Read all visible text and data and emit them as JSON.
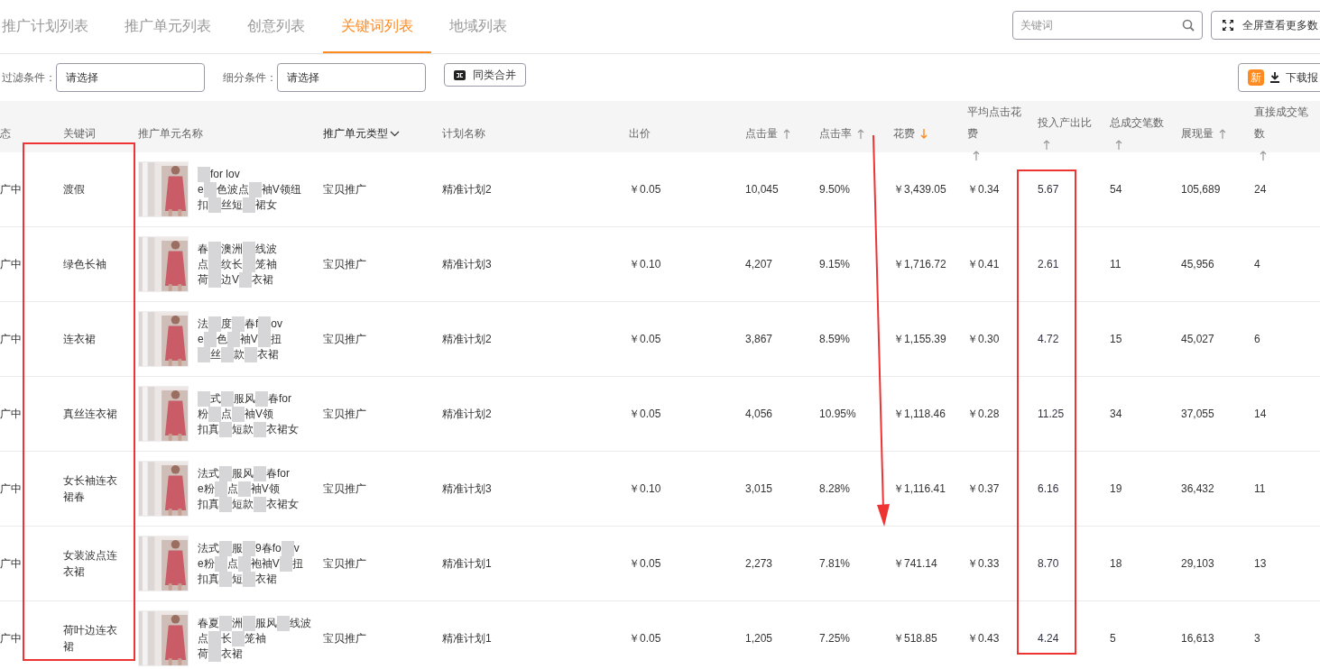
{
  "tabs": [
    {
      "label": "推广计划列表",
      "selected": false
    },
    {
      "label": "推广单元列表",
      "selected": false
    },
    {
      "label": "创意列表",
      "selected": false
    },
    {
      "label": "关键词列表",
      "selected": true
    },
    {
      "label": "地域列表",
      "selected": false
    }
  ],
  "search": {
    "placeholder": "关键词"
  },
  "fullscreen_button": "全屏查看更多数",
  "filters": [
    {
      "label": "过滤条件：",
      "value": "请选择"
    },
    {
      "label": "细分条件：",
      "value": "请选择"
    }
  ],
  "merge_button": "同类合并",
  "download": {
    "badge": "新",
    "label": "下载报"
  },
  "table": {
    "columns": [
      {
        "label": "态"
      },
      {
        "label": "关键词"
      },
      {
        "label": "推广单元名称"
      },
      {
        "label": "推广单元类型",
        "dropdown": true
      },
      {
        "label": "计划名称"
      },
      {
        "label": "出价"
      },
      {
        "label": "点击量",
        "sortable": true,
        "sorted": false
      },
      {
        "label": "点击率",
        "sortable": true,
        "sorted": false
      },
      {
        "label": "花费",
        "sortable": true,
        "sorted": true
      },
      {
        "label": "平均点击花费",
        "sortable": true,
        "sorted": false
      },
      {
        "label": "投入产出比",
        "sortable": true,
        "sorted": false
      },
      {
        "label": "总成交笔数",
        "sortable": true,
        "sorted": false
      },
      {
        "label": "展现量",
        "sortable": true,
        "sorted": false
      },
      {
        "label": "直接成交笔数",
        "sortable": true,
        "sorted": false
      }
    ],
    "rows": [
      {
        "status": "广中",
        "keyword": "渡假",
        "unit_name": [
          [
            {
              "kind": "mask"
            },
            "for lov"
          ],
          [
            "e",
            {
              "kind": "mask"
            },
            "色波点",
            {
              "kind": "mask"
            },
            "袖V领纽"
          ],
          [
            "扣",
            {
              "kind": "mask"
            },
            "丝短",
            {
              "kind": "mask"
            },
            "裙女"
          ]
        ],
        "unit_type": "宝贝推广",
        "plan": "精准计划2",
        "bid": "￥0.05",
        "clicks": "10,045",
        "ctr": "9.50%",
        "cost": "￥3,439.05",
        "avg_cpc": "￥0.34",
        "roi": "5.67",
        "total_deals": "54",
        "impressions": "105,689",
        "direct_deals": "24"
      },
      {
        "status": "广中",
        "keyword": "绿色长袖",
        "unit_name": [
          [
            "春",
            {
              "kind": "mask"
            },
            "澳洲",
            {
              "kind": "mask"
            },
            "线波"
          ],
          [
            "点",
            {
              "kind": "mask"
            },
            "纹长",
            {
              "kind": "mask"
            },
            "笼袖"
          ],
          [
            "荷",
            {
              "kind": "mask"
            },
            "边V",
            {
              "kind": "mask"
            },
            "衣裙"
          ]
        ],
        "unit_type": "宝贝推广",
        "plan": "精准计划3",
        "bid": "￥0.10",
        "clicks": "4,207",
        "ctr": "9.15%",
        "cost": "￥1,716.72",
        "avg_cpc": "￥0.41",
        "roi": "2.61",
        "total_deals": "11",
        "impressions": "45,956",
        "direct_deals": "4"
      },
      {
        "status": "广中",
        "keyword": "连衣裙",
        "unit_name": [
          [
            "法",
            {
              "kind": "mask"
            },
            "度",
            {
              "kind": "mask"
            },
            "春f",
            {
              "kind": "mask"
            },
            "ov"
          ],
          [
            "e",
            {
              "kind": "mask"
            },
            "色",
            {
              "kind": "mask"
            },
            "袖V",
            {
              "kind": "mask"
            },
            "扭"
          ],
          [
            {
              "kind": "mask"
            },
            "丝",
            {
              "kind": "mask"
            },
            "款",
            {
              "kind": "mask"
            },
            "衣裙"
          ]
        ],
        "unit_type": "宝贝推广",
        "plan": "精准计划2",
        "bid": "￥0.05",
        "clicks": "3,867",
        "ctr": "8.59%",
        "cost": "￥1,155.39",
        "avg_cpc": "￥0.30",
        "roi": "4.72",
        "total_deals": "15",
        "impressions": "45,027",
        "direct_deals": "6"
      },
      {
        "status": "广中",
        "keyword": "真丝连衣裙",
        "unit_name": [
          [
            {
              "kind": "mask"
            },
            "式",
            {
              "kind": "mask"
            },
            "服风",
            {
              "kind": "mask"
            },
            "春for"
          ],
          [
            "粉",
            {
              "kind": "mask"
            },
            "点",
            {
              "kind": "mask"
            },
            "袖V领"
          ],
          [
            "扣真",
            {
              "kind": "mask"
            },
            "短款",
            {
              "kind": "mask"
            },
            "衣裙女"
          ]
        ],
        "unit_type": "宝贝推广",
        "plan": "精准计划2",
        "bid": "￥0.05",
        "clicks": "4,056",
        "ctr": "10.95%",
        "cost": "￥1,118.46",
        "avg_cpc": "￥0.28",
        "roi": "11.25",
        "total_deals": "34",
        "impressions": "37,055",
        "direct_deals": "14"
      },
      {
        "status": "广中",
        "keyword": "女长袖连衣裙春",
        "unit_name": [
          [
            "法式",
            {
              "kind": "mask"
            },
            "服风",
            {
              "kind": "mask"
            },
            "春for"
          ],
          [
            "e粉",
            {
              "kind": "mask"
            },
            "点",
            {
              "kind": "mask"
            },
            "袖V领"
          ],
          [
            "扣真",
            {
              "kind": "mask"
            },
            "短款",
            {
              "kind": "mask"
            },
            "衣裙女"
          ]
        ],
        "unit_type": "宝贝推广",
        "plan": "精准计划3",
        "bid": "￥0.10",
        "clicks": "3,015",
        "ctr": "8.28%",
        "cost": "￥1,116.41",
        "avg_cpc": "￥0.37",
        "roi": "6.16",
        "total_deals": "19",
        "impressions": "36,432",
        "direct_deals": "11"
      },
      {
        "status": "广中",
        "keyword": "女装波点连衣裙",
        "unit_name": [
          [
            "法式",
            {
              "kind": "mask"
            },
            "服",
            {
              "kind": "mask"
            },
            "9春fo",
            {
              "kind": "mask"
            },
            "v"
          ],
          [
            "e粉",
            {
              "kind": "mask"
            },
            "点",
            {
              "kind": "mask"
            },
            "袍袖V",
            {
              "kind": "mask"
            },
            "扭"
          ],
          [
            "扣真",
            {
              "kind": "mask"
            },
            "短",
            {
              "kind": "mask"
            },
            "衣裙"
          ]
        ],
        "unit_type": "宝贝推广",
        "plan": "精准计划1",
        "bid": "￥0.05",
        "clicks": "2,273",
        "ctr": "7.81%",
        "cost": "￥741.14",
        "avg_cpc": "￥0.33",
        "roi": "8.70",
        "total_deals": "18",
        "impressions": "29,103",
        "direct_deals": "13"
      },
      {
        "status": "广中",
        "keyword": "荷叶边连衣裙",
        "unit_name": [
          [
            "春夏",
            {
              "kind": "mask"
            },
            "洲",
            {
              "kind": "mask"
            },
            "服风",
            {
              "kind": "mask"
            },
            "线波"
          ],
          [
            "点",
            {
              "kind": "mask"
            },
            "长",
            {
              "kind": "mask"
            },
            "笼袖"
          ],
          [
            "荷",
            {
              "kind": "mask"
            },
            "衣裙"
          ]
        ],
        "unit_type": "宝贝推广",
        "plan": "精准计划1",
        "bid": "￥0.05",
        "clicks": "1,205",
        "ctr": "7.25%",
        "cost": "￥518.85",
        "avg_cpc": "￥0.43",
        "roi": "4.24",
        "total_deals": "5",
        "impressions": "16,613",
        "direct_deals": "3"
      }
    ]
  },
  "annotations": [
    {
      "kind": "box"
    },
    {
      "kind": "box"
    },
    {
      "kind": "arrow"
    }
  ]
}
